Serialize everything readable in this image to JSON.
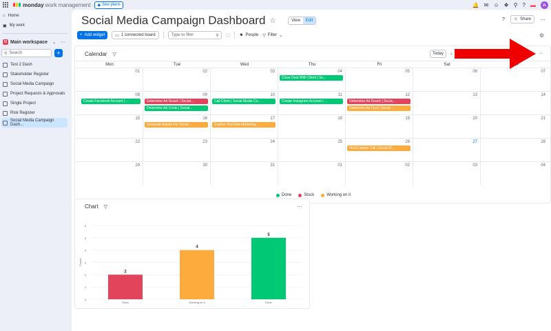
{
  "topbar": {
    "brand": "monday",
    "brand_sub": "work management",
    "see_plans": "See plans",
    "avatar": "JL"
  },
  "sidebar": {
    "home": "Home",
    "my_work": "My work",
    "workspace_badge": "M",
    "workspace": "Main workspace",
    "search_placeholder": "Search",
    "items": [
      {
        "label": "Test 2 Dash"
      },
      {
        "label": "Stakeholder Register"
      },
      {
        "label": "Social Media Campaign"
      },
      {
        "label": "Project Requests & Approvals"
      },
      {
        "label": "Single Project"
      },
      {
        "label": "Risk Register"
      },
      {
        "label": "Social Media Campaign Dash..."
      }
    ]
  },
  "header": {
    "title": "Social Media Campaign Dashboard",
    "view_label": "View",
    "edit_label": "Edit",
    "share_label": "Share"
  },
  "toolbar": {
    "add_widget": "Add widget",
    "connected_board": "1 connected board",
    "filter_placeholder": "Type to filter",
    "people": "People",
    "filter": "Filter"
  },
  "calendar": {
    "title": "Calendar",
    "today": "Today",
    "days": [
      "Mon",
      "Tue",
      "Wed",
      "Thu",
      "Fri",
      "Sat",
      "Sun"
    ],
    "weeks": [
      [
        "01",
        "02",
        "03",
        "04",
        "05",
        "06",
        "07"
      ],
      [
        "08",
        "09",
        "10",
        "11",
        "12",
        "13",
        "14"
      ],
      [
        "15",
        "16",
        "17",
        "18",
        "19",
        "20",
        "21"
      ],
      [
        "22",
        "23",
        "24",
        "25",
        "26",
        "27",
        "28"
      ],
      [
        "29",
        "30",
        "31",
        "01",
        "02",
        "03",
        "04"
      ]
    ],
    "events": {
      "thu01": "Close Deal With Client | So...",
      "mon02": "Create Facebook Account | ...",
      "tue02a": "Determine Ad Reach | Social...",
      "tue02b": "Determine Ad Costs | Social...",
      "wed02": "Call Client | Social Media Ca...",
      "thu02": "Create Instagram Account | ...",
      "fri02a": "Determine Ad Reach | Socia...",
      "fri02b": "Determine Ad Cost | Social ...",
      "tue03": "Generate Assets For Social ...",
      "wed03": "Explore YouTube Marketing ...",
      "fri04": "Final Update Call | Social M..."
    },
    "legend": {
      "done": "Done",
      "stuck": "Stuck",
      "working": "Working on it"
    }
  },
  "colors": {
    "done": "#00c875",
    "stuck": "#e2445c",
    "working": "#fdab3d",
    "accent": "#0073ea"
  },
  "chart_widget": {
    "title": "Chart"
  },
  "chart_data": {
    "type": "bar",
    "categories": [
      "Stuck",
      "Working on it",
      "Done"
    ],
    "values": [
      2,
      4,
      5
    ],
    "colors": [
      "#e2445c",
      "#fdab3d",
      "#00c875"
    ],
    "ylabel": "Count",
    "ylim": [
      0,
      6
    ],
    "yticks": [
      "0",
      "1",
      "2",
      "3",
      "4",
      "5",
      "6"
    ],
    "grid": true
  }
}
